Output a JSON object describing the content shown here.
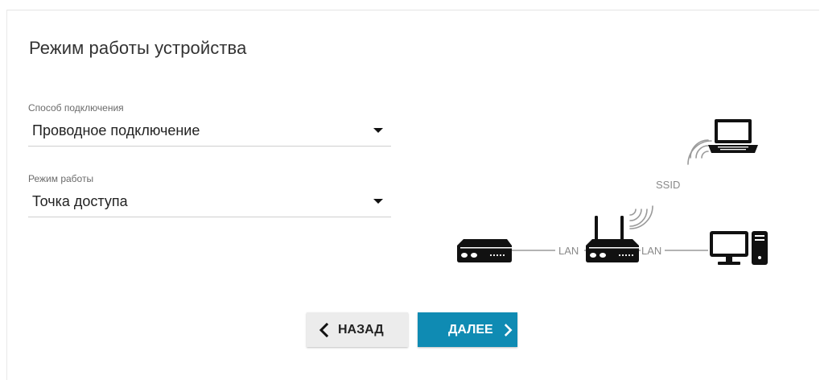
{
  "page": {
    "title": "Режим работы устройства"
  },
  "connection_method": {
    "label": "Способ подключения",
    "value": "Проводное подключение"
  },
  "work_mode": {
    "label": "Режим работы",
    "value": "Точка доступа"
  },
  "diagram": {
    "ssid_label": "SSID",
    "lan_left_label": "LAN",
    "lan_right_label": "LAN"
  },
  "buttons": {
    "back_label": "НАЗАД",
    "next_label": "ДАЛЕЕ"
  },
  "colors": {
    "accent": "#0f8bb3",
    "device_dark": "#111111",
    "line_gray": "#9a9a9a"
  }
}
